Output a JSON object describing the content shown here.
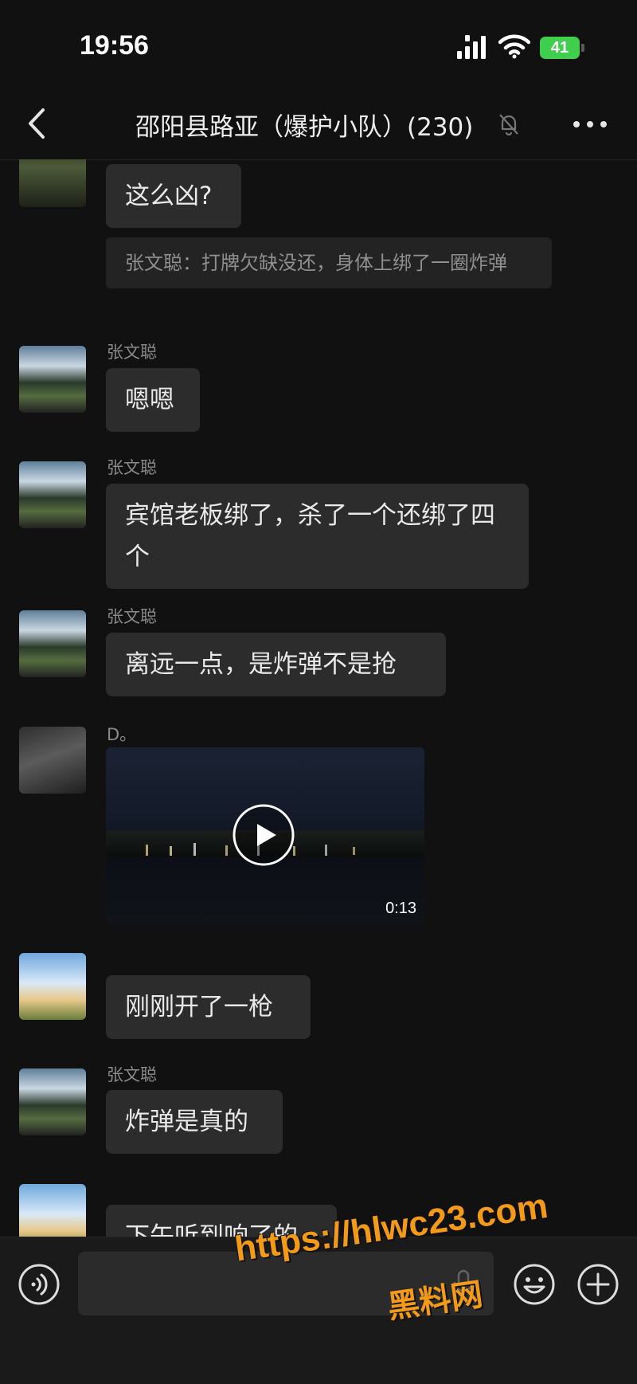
{
  "status": {
    "time": "19:56",
    "battery": "41"
  },
  "nav": {
    "title": "邵阳县路亚（爆护小队）(230)"
  },
  "messages": [
    {
      "text": "这么凶?",
      "quote": "张文聪：打牌欠缺没还，身体上绑了一圈炸弹"
    },
    {
      "sender": "张文聪",
      "text": "嗯嗯"
    },
    {
      "sender": "张文聪",
      "text": "宾馆老板绑了，杀了一个还绑了四个"
    },
    {
      "sender": "张文聪",
      "text": "离远一点，是炸弹不是抢"
    },
    {
      "sender": "D。",
      "video_duration": "0:13"
    },
    {
      "text": "刚刚开了一枪"
    },
    {
      "sender": "张文聪",
      "text": "炸弹是真的"
    },
    {
      "text": "下午听到响了的"
    }
  ],
  "watermark": {
    "url": "https://hlwc23.com",
    "name": "黑料网"
  },
  "colors": {
    "accent": "#f39a18",
    "battery": "#3fce4e",
    "bubble": "#2c2c2c",
    "background": "#111111"
  },
  "icons": [
    "back-icon",
    "mute-icon",
    "more-icon",
    "play-icon",
    "voice-icon",
    "mic-icon",
    "emoji-icon",
    "plus-icon"
  ]
}
